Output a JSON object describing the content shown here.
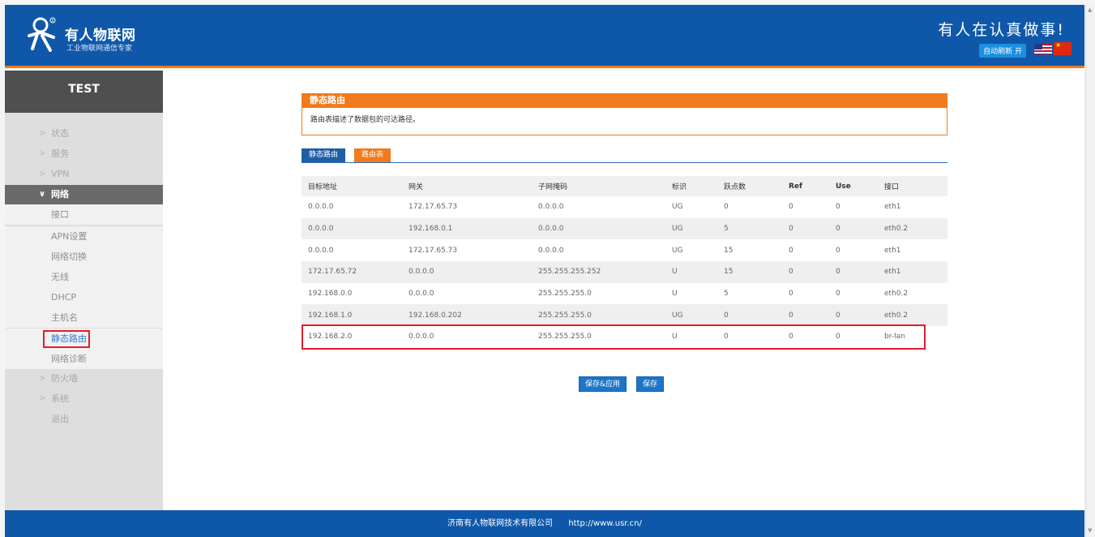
{
  "header": {
    "brand_name": "有人物联网",
    "brand_sub": "工业物联网通信专家",
    "slogan": "有人在认真做事!",
    "auto_refresh": "自动刷新 开",
    "flags": [
      "us-flag-icon",
      "cn-flag-icon"
    ],
    "colors": {
      "header_bg": "#0f58a9",
      "accent": "#f07a1c"
    }
  },
  "sidebar": {
    "title": "TEST",
    "menu": [
      {
        "label": "状态",
        "icon": "chevron-right-icon"
      },
      {
        "label": "服务",
        "icon": "chevron-right-icon"
      },
      {
        "label": "VPN",
        "icon": "chevron-right-icon"
      },
      {
        "label": "网络",
        "icon": "chevron-down-icon"
      },
      {
        "label": "防火墙",
        "icon": "chevron-right-icon"
      },
      {
        "label": "系统",
        "icon": "chevron-right-icon"
      },
      {
        "label": "退出"
      }
    ],
    "submenu": [
      "接口",
      "APN设置",
      "网络切换",
      "无线",
      "DHCP",
      "主机名",
      "静态路由",
      "网络诊断"
    ]
  },
  "panel": {
    "title": "静态路由",
    "description": "路由表描述了数据包的可达路径。"
  },
  "tabs": [
    "静态路由",
    "路由表"
  ],
  "table": {
    "headers": [
      "目标地址",
      "网关",
      "子网掩码",
      "标识",
      "跃点数",
      "Ref",
      "Use",
      "接口"
    ],
    "rows": [
      [
        "0.0.0.0",
        "172.17.65.73",
        "0.0.0.0",
        "UG",
        "0",
        "0",
        "0",
        "eth1"
      ],
      [
        "0.0.0.0",
        "192.168.0.1",
        "0.0.0.0",
        "UG",
        "5",
        "0",
        "0",
        "eth0.2"
      ],
      [
        "0.0.0.0",
        "172.17.65.73",
        "0.0.0.0",
        "UG",
        "15",
        "0",
        "0",
        "eth1"
      ],
      [
        "172.17.65.72",
        "0.0.0.0",
        "255.255.255.252",
        "U",
        "15",
        "0",
        "0",
        "eth1"
      ],
      [
        "192.168.0.0",
        "0.0.0.0",
        "255.255.255.0",
        "U",
        "5",
        "0",
        "0",
        "eth0.2"
      ],
      [
        "192.168.1.0",
        "192.168.0.202",
        "255.255.255.0",
        "UG",
        "0",
        "0",
        "0",
        "eth0.2"
      ],
      [
        "192.168.2.0",
        "0.0.0.0",
        "255.255.255.0",
        "U",
        "0",
        "0",
        "0",
        "br-lan"
      ]
    ]
  },
  "buttons": {
    "save_apply": "保存&应用",
    "save": "保存"
  },
  "footer": {
    "company": "济南有人物联网技术有限公司",
    "url": "http://www.usr.cn/"
  }
}
